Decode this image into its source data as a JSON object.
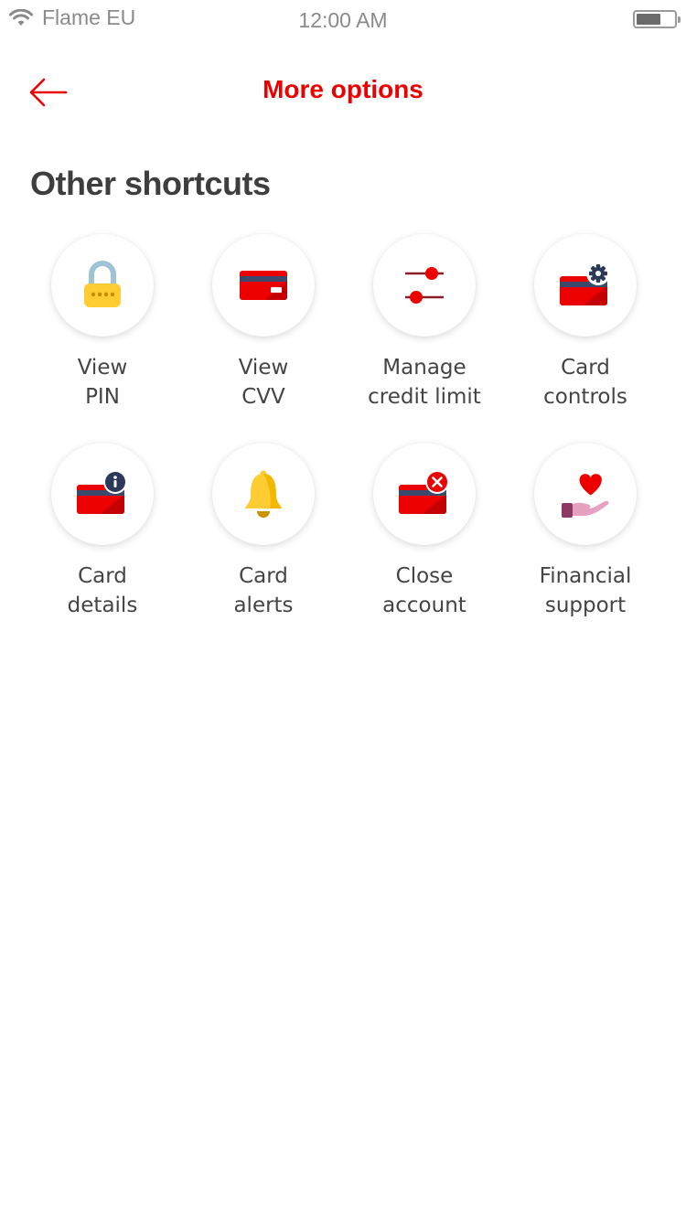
{
  "status_bar": {
    "carrier": "Flame EU",
    "time": "12:00 AM",
    "wifi_icon": "wifi-icon",
    "battery_icon": "battery-icon"
  },
  "header": {
    "back_icon": "arrow-left-icon",
    "title": "More options"
  },
  "section": {
    "title": "Other shortcuts"
  },
  "colors": {
    "brand_red": "#ec0000",
    "navy": "#2c3a5a",
    "yellow": "#ffcc33"
  },
  "shortcuts": [
    {
      "icon": "padlock-icon",
      "line1": "View",
      "line2": "PIN"
    },
    {
      "icon": "card-icon",
      "line1": "View",
      "line2": "CVV"
    },
    {
      "icon": "sliders-icon",
      "line1": "Manage",
      "line2": "credit limit"
    },
    {
      "icon": "card-settings-icon",
      "line1": "Card",
      "line2": "controls"
    },
    {
      "icon": "card-info-icon",
      "line1": "Card",
      "line2": "details"
    },
    {
      "icon": "bell-icon",
      "line1": "Card",
      "line2": "alerts"
    },
    {
      "icon": "card-close-icon",
      "line1": "Close",
      "line2": "account"
    },
    {
      "icon": "heart-hand-icon",
      "line1": "Financial",
      "line2": "support"
    }
  ]
}
